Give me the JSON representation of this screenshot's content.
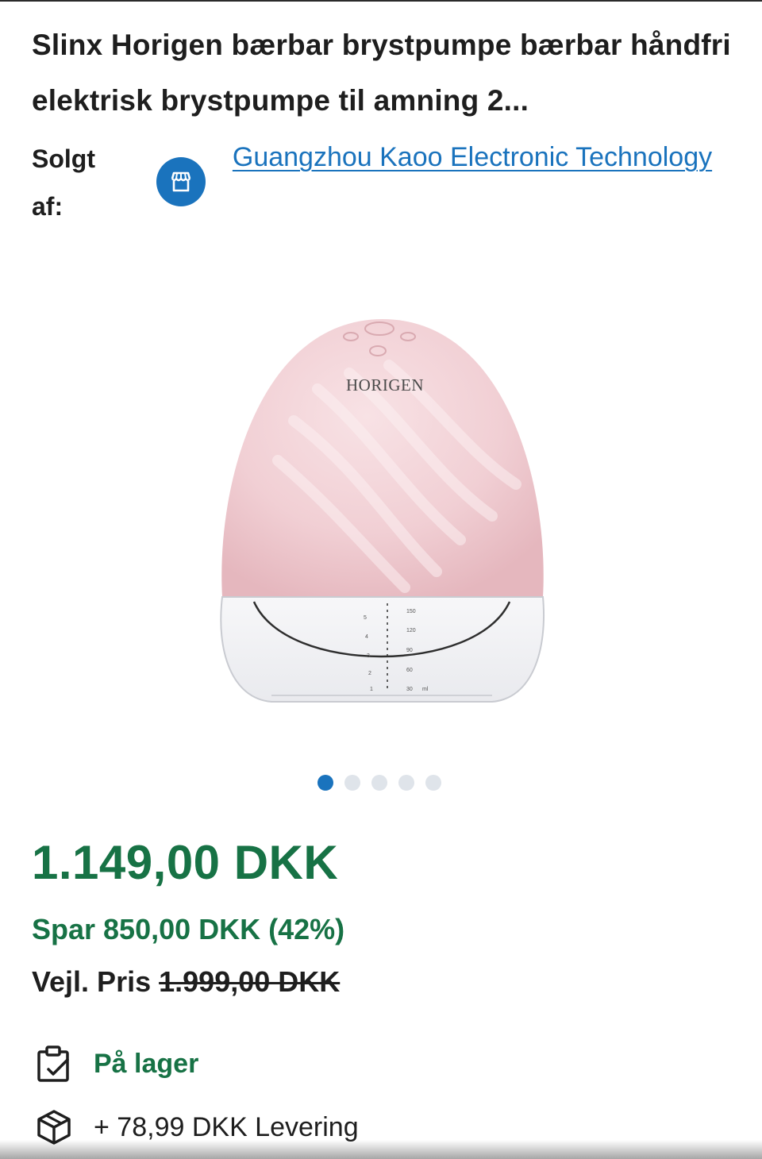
{
  "product": {
    "title": "Slinx Horigen bærbar brystpumpe bærbar håndfri elektrisk brystpumpe til amning 2...",
    "seller_label": "Solgt af:",
    "seller_name": "Guangzhou Kaoo Electronic Technology",
    "image": {
      "brand_text": "HORIGEN",
      "scale_ml": [
        "150",
        "120",
        "90",
        "60",
        "30",
        "ml"
      ],
      "scale_oz": [
        "5",
        "4",
        "3",
        "2",
        "1"
      ]
    },
    "carousel": {
      "count": 5,
      "active_index": 0
    }
  },
  "pricing": {
    "price": "1.149,00 DKK",
    "save": "Spar 850,00 DKK (42%)",
    "rrp_label": "Vejl. Pris",
    "rrp_value": "1.999,00 DKK"
  },
  "availability": {
    "stock": "På lager",
    "delivery": "+ 78,99 DKK Levering"
  },
  "icons": {
    "seller": "store-icon",
    "stock": "clipboard-check-icon",
    "delivery": "package-box-icon"
  },
  "colors": {
    "link_blue": "#1a73bd",
    "price_green": "#177245",
    "product_pink": "#f3d4d8"
  }
}
